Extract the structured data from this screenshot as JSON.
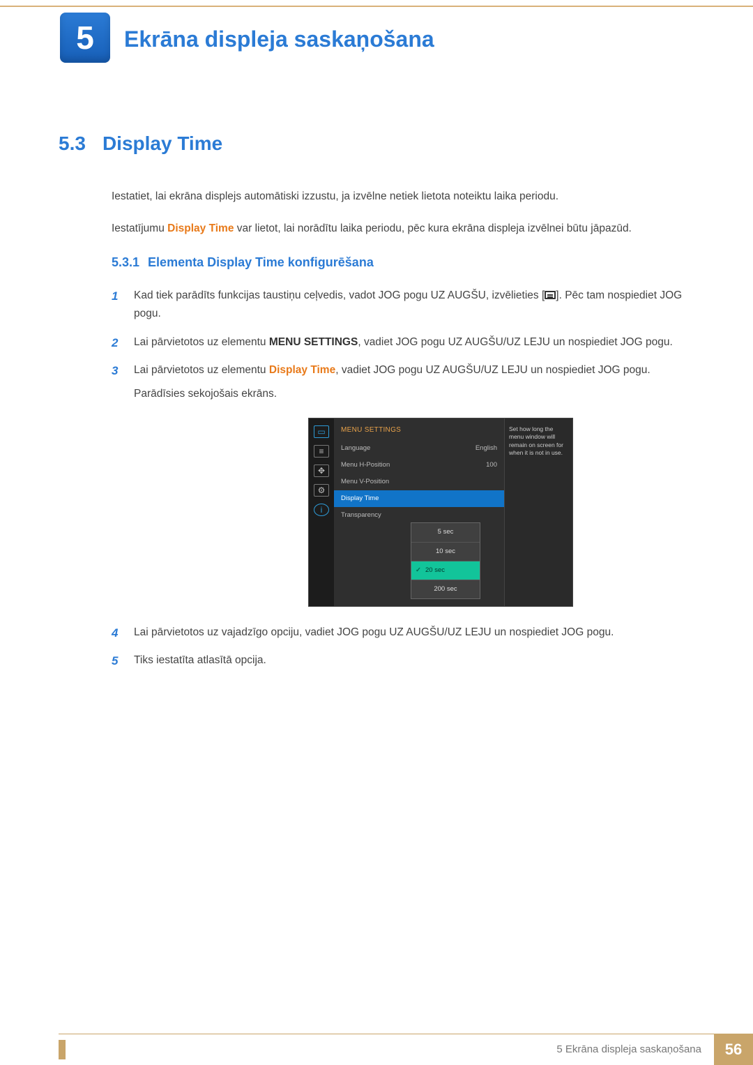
{
  "header": {
    "chapter_number": "5",
    "chapter_title": "Ekrāna displeja saskaņošana"
  },
  "section": {
    "number": "5.3",
    "title": "Display Time",
    "intro1": "Iestatiet, lai ekrāna displejs automātiski izzustu, ja izvēlne netiek lietota noteiktu laika periodu.",
    "intro2_a": "Iestatījumu ",
    "intro2_bold": "Display Time",
    "intro2_b": " var lietot, lai norādītu laika periodu, pēc kura ekrāna displeja izvēlnei būtu jāpazūd."
  },
  "subsection": {
    "number": "5.3.1",
    "title": "Elementa Display Time konfigurēšana"
  },
  "steps": [
    {
      "n": "1",
      "p1": "Kad tiek parādīts funkcijas taustiņu ceļvedis, vadot JOG pogu UZ AUGŠU, izvēlieties [",
      "p2": "]. Pēc tam nospiediet JOG pogu."
    },
    {
      "n": "2",
      "p1": "Lai pārvietotos uz elementu ",
      "bold": "MENU SETTINGS",
      "p2": ", vadiet JOG pogu UZ AUGŠU/UZ LEJU un nospiediet JOG pogu."
    },
    {
      "n": "3",
      "p1": "Lai pārvietotos uz elementu ",
      "orange": "Display Time",
      "p2": ", vadiet JOG pogu UZ AUGŠU/UZ LEJU un nospiediet JOG pogu.",
      "p3": "Parādīsies sekojošais ekrāns."
    },
    {
      "n": "4",
      "p1": "Lai pārvietotos uz vajadzīgo opciju, vadiet JOG pogu UZ AUGŠU/UZ LEJU un nospiediet JOG pogu."
    },
    {
      "n": "5",
      "p1": "Tiks iestatīta atlasītā opcija."
    }
  ],
  "osd": {
    "title": "MENU SETTINGS",
    "rows": [
      {
        "label": "Language",
        "value": "English"
      },
      {
        "label": "Menu H-Position",
        "value": "100"
      },
      {
        "label": "Menu V-Position",
        "value": ""
      },
      {
        "label": "Display Time",
        "value": ""
      },
      {
        "label": "Transparency",
        "value": ""
      }
    ],
    "options": [
      "5 sec",
      "10 sec",
      "20 sec",
      "200 sec"
    ],
    "selected_option": "20 sec",
    "side_text": "Set how long the menu window will remain on screen for when it is not in use."
  },
  "footer": {
    "chapter_label": "5 Ekrāna displeja saskaņošana",
    "page_number": "56"
  }
}
